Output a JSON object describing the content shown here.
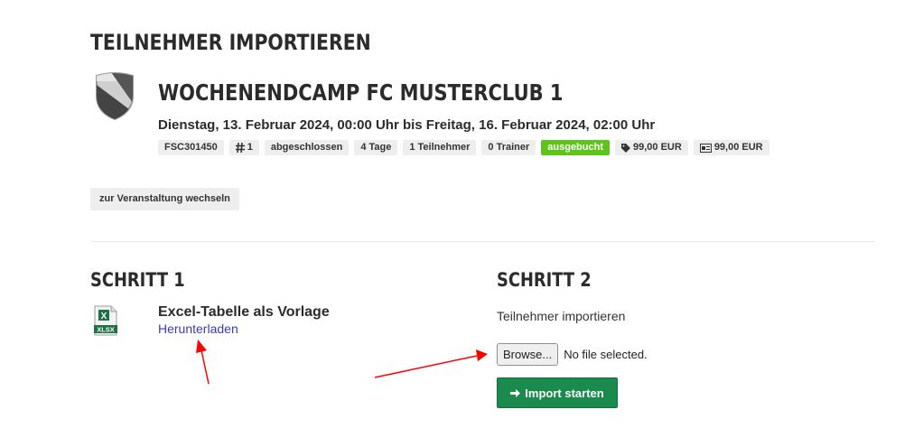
{
  "page": {
    "title": "TEILNEHMER IMPORTIEREN"
  },
  "event": {
    "title": "WOCHENENDCAMP FC MUSTERCLUB 1",
    "dates": "Dienstag, 13. Februar 2024, 00:00 Uhr bis Freitag, 16. Februar 2024, 02:00 Uhr",
    "badges": {
      "code": "FSC301450",
      "number": "1",
      "status": "abgeschlossen",
      "duration": "4 Tage",
      "participants": "1 Teilnehmer",
      "trainers": "0 Trainer",
      "availability": "ausgebucht",
      "price": "99,00 EUR",
      "price_card": "99,00 EUR"
    },
    "switch_label": "zur Veranstaltung wechseln"
  },
  "step1": {
    "heading": "SCHRITT 1",
    "template_title": "Excel-Tabelle als Vorlage",
    "download_label": "Herunterladen",
    "file_icon_text": "XLSX"
  },
  "step2": {
    "heading": "SCHRITT 2",
    "label": "Teilnehmer importieren",
    "browse_label": "Browse...",
    "file_status": "No file selected.",
    "import_label": "Import starten"
  },
  "colors": {
    "availability_badge": "#5cc41a",
    "import_button": "#1a8a4d",
    "link": "#3b3bb0",
    "annotation_arrow": "#ff0000"
  },
  "icons": [
    "shield-logo-icon",
    "hash-icon",
    "tag-icon",
    "card-icon",
    "xlsx-file-icon",
    "arrow-right-icon"
  ]
}
